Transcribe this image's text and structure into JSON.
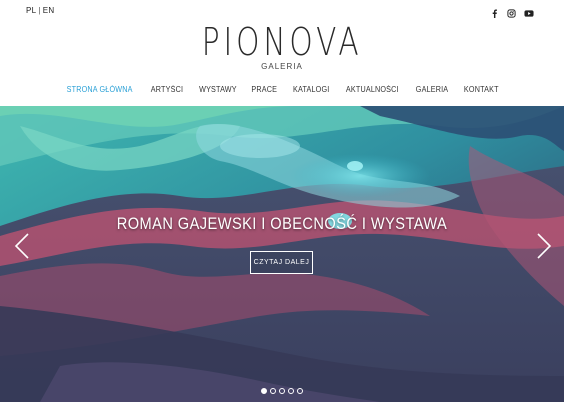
{
  "lang": {
    "pl": "PL",
    "separator": "|",
    "en": "EN"
  },
  "social": [
    "facebook-icon",
    "instagram-icon",
    "youtube-icon"
  ],
  "brand": {
    "logo": "PIONOVA",
    "subtitle": "GALERIA"
  },
  "nav": {
    "items": [
      {
        "label": "STRONA GŁÓWNA",
        "active": true
      },
      {
        "label": "ARTYŚCI"
      },
      {
        "label": "WYSTAWY"
      },
      {
        "label": "PRACE"
      },
      {
        "label": "KATALOGI"
      },
      {
        "label": "AKTUALNOŚCI"
      },
      {
        "label": "GALERIA"
      },
      {
        "label": "KONTAKT"
      }
    ]
  },
  "hero": {
    "title": "ROMAN GAJEWSKI I OBECNOŚĆ I WYSTAWA",
    "button": "CZYTAJ DALEJ",
    "slides_total": 5,
    "active_slide": 1
  },
  "colors": {
    "accent": "#2aa0d6",
    "text": "#222222"
  }
}
